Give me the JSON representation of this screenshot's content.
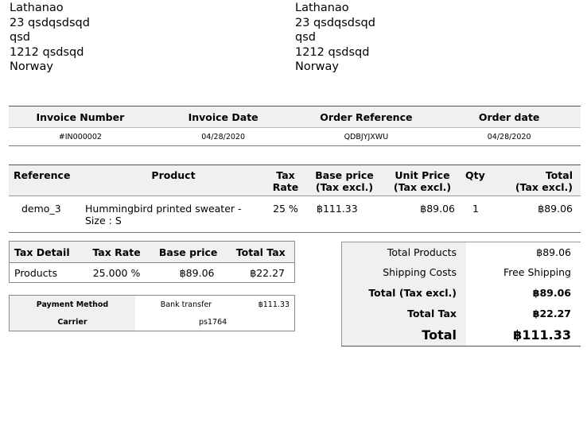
{
  "addresses": {
    "left": [
      "Lathanao",
      "23 qsdqsdsqd",
      "qsd",
      "1212 qsdsqd",
      "Norway"
    ],
    "right": [
      "Lathanao",
      "23 qsdqsdsqd",
      "qsd",
      "1212 qsdsqd",
      "Norway"
    ]
  },
  "invoice_info": {
    "headers": [
      "Invoice Number",
      "Invoice Date",
      "Order Reference",
      "Order date"
    ],
    "values": [
      "#IN000002",
      "04/28/2020",
      "QDBJYJXWU",
      "04/28/2020"
    ]
  },
  "products": {
    "headers": {
      "reference": "Reference",
      "product": "Product",
      "tax_rate": [
        "Tax",
        "Rate"
      ],
      "base_price": [
        "Base price",
        "(Tax excl.)"
      ],
      "unit_price": [
        "Unit Price",
        "(Tax excl.)"
      ],
      "qty": "Qty",
      "total": [
        "Total",
        "(Tax excl.)"
      ]
    },
    "rows": [
      {
        "reference": "demo_3",
        "product": "Hummingbird printed sweater - Size : S",
        "tax_rate": "25 %",
        "base_price": "฿111.33",
        "unit_price": "฿89.06",
        "qty": "1",
        "total": "฿89.06"
      }
    ]
  },
  "tax_detail": {
    "headers": [
      "Tax Detail",
      "Tax Rate",
      "Base price",
      "Total Tax"
    ],
    "rows": [
      [
        "Products",
        "25.000 %",
        "฿89.06",
        "฿22.27"
      ]
    ]
  },
  "payment": {
    "method_label": "Payment Method",
    "method_value": "Bank transfer",
    "method_amount": "฿111.33",
    "carrier_label": "Carrier",
    "carrier_value": "ps1764"
  },
  "totals": {
    "total_products_label": "Total Products",
    "total_products": "฿89.06",
    "shipping_label": "Shipping Costs",
    "shipping": "Free Shipping",
    "total_tax_excl_label": "Total (Tax excl.)",
    "total_tax_excl": "฿89.06",
    "total_tax_label": "Total Tax",
    "total_tax": "฿22.27",
    "total_label": "Total",
    "total": "฿111.33"
  }
}
